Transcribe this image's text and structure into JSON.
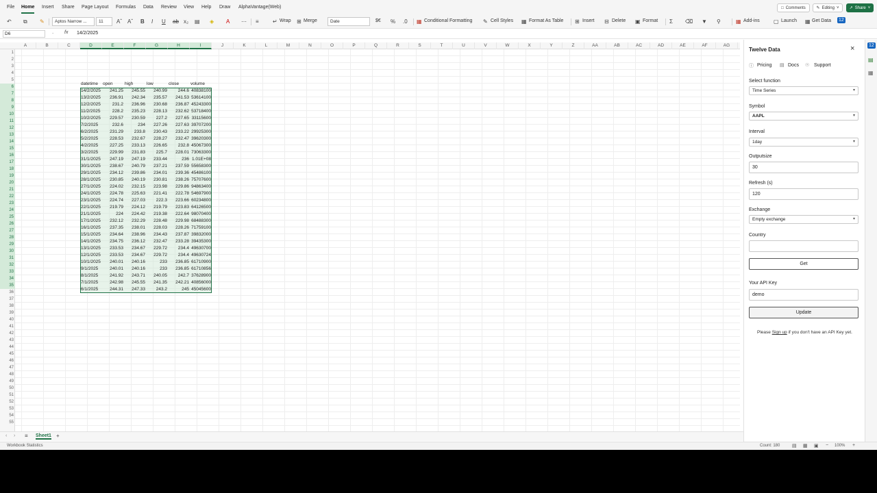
{
  "menu": {
    "tabs": [
      "File",
      "Home",
      "Insert",
      "Share",
      "Page Layout",
      "Formulas",
      "Data",
      "Review",
      "View",
      "Help",
      "Draw",
      "AlphaVantage(Web)"
    ],
    "comments": "Comments",
    "editing": "Editing",
    "share": "Share"
  },
  "ribbon": {
    "font_name": "Aptos Narrow ...",
    "font_size": "11",
    "wrap": "Wrap",
    "merge": "Merge",
    "number_format": "Date",
    "currency": "$€",
    "conditional_formatting": "Conditional Formatting",
    "cell_styles": "Cell Styles",
    "format_as_table": "Format As Table",
    "insert": "Insert",
    "delete": "Delete",
    "format": "Format",
    "add_ins": "Add-ins",
    "launch": "Launch",
    "get_data": "Get Data",
    "twelve_badge": "12"
  },
  "formula": {
    "cell_ref": "D6",
    "fx": "fx",
    "value": "14/2/2025"
  },
  "grid": {
    "columns": [
      "A",
      "B",
      "C",
      "D",
      "E",
      "F",
      "G",
      "H",
      "I",
      "J",
      "K",
      "L",
      "M",
      "N",
      "O",
      "P",
      "Q",
      "R",
      "S",
      "T",
      "U",
      "V",
      "W",
      "X",
      "Y",
      "Z",
      "AA",
      "AB",
      "AC",
      "AD",
      "AE",
      "AF",
      "AG"
    ],
    "headers": [
      "datetime",
      "open",
      "high",
      "low",
      "close",
      "volume"
    ],
    "rows": [
      [
        "14/2/2025",
        "241.25",
        "245.55",
        "240.99",
        "244.6",
        "40838100"
      ],
      [
        "13/2/2025",
        "236.91",
        "242.34",
        "235.57",
        "241.53",
        "53614100"
      ],
      [
        "12/2/2025",
        "231.2",
        "236.96",
        "230.68",
        "236.87",
        "45243300"
      ],
      [
        "11/2/2025",
        "228.2",
        "235.23",
        "228.13",
        "232.62",
        "53718400"
      ],
      [
        "10/2/2025",
        "229.57",
        "230.59",
        "227.2",
        "227.65",
        "33115600"
      ],
      [
        "7/2/2025",
        "232.6",
        "234",
        "227.26",
        "227.63",
        "39707200"
      ],
      [
        "6/2/2025",
        "231.29",
        "233.8",
        "230.43",
        "233.22",
        "29925300"
      ],
      [
        "5/2/2025",
        "228.53",
        "232.67",
        "228.27",
        "232.47",
        "39620300"
      ],
      [
        "4/2/2025",
        "227.25",
        "233.13",
        "226.65",
        "232.8",
        "45067300"
      ],
      [
        "3/2/2025",
        "229.99",
        "231.83",
        "225.7",
        "228.01",
        "73063300"
      ],
      [
        "31/1/2025",
        "247.19",
        "247.19",
        "233.44",
        "236",
        "1.01E+08"
      ],
      [
        "30/1/2025",
        "238.67",
        "240.79",
        "237.21",
        "237.59",
        "55658300"
      ],
      [
        "29/1/2025",
        "234.12",
        "239.86",
        "234.01",
        "239.36",
        "45486100"
      ],
      [
        "28/1/2025",
        "230.85",
        "240.19",
        "230.81",
        "238.26",
        "75707600"
      ],
      [
        "27/1/2025",
        "224.02",
        "232.15",
        "223.98",
        "229.86",
        "94863400"
      ],
      [
        "24/1/2025",
        "224.78",
        "225.63",
        "221.41",
        "222.78",
        "54697900"
      ],
      [
        "23/1/2025",
        "224.74",
        "227.03",
        "222.3",
        "223.66",
        "60234800"
      ],
      [
        "22/1/2025",
        "219.79",
        "224.12",
        "219.79",
        "223.83",
        "64126500"
      ],
      [
        "21/1/2025",
        "224",
        "224.42",
        "219.38",
        "222.64",
        "98070400"
      ],
      [
        "17/1/2025",
        "232.12",
        "232.29",
        "228.48",
        "229.98",
        "68488300"
      ],
      [
        "16/1/2025",
        "237.35",
        "238.01",
        "228.03",
        "228.26",
        "71759100"
      ],
      [
        "15/1/2025",
        "234.64",
        "238.96",
        "234.43",
        "237.87",
        "39832000"
      ],
      [
        "14/1/2025",
        "234.75",
        "236.12",
        "232.47",
        "233.28",
        "39435300"
      ],
      [
        "13/1/2025",
        "233.53",
        "234.67",
        "229.72",
        "234.4",
        "49630700"
      ],
      [
        "12/1/2025",
        "233.53",
        "234.67",
        "229.72",
        "234.4",
        "49630724"
      ],
      [
        "10/1/2025",
        "240.01",
        "240.16",
        "233",
        "236.85",
        "61710900"
      ],
      [
        "9/1/2025",
        "240.01",
        "240.16",
        "233",
        "236.85",
        "61710856"
      ],
      [
        "8/1/2025",
        "241.92",
        "243.71",
        "240.05",
        "242.7",
        "37628900"
      ],
      [
        "7/1/2025",
        "242.98",
        "245.55",
        "241.35",
        "242.21",
        "40856000"
      ],
      [
        "6/1/2025",
        "244.31",
        "247.33",
        "243.2",
        "245",
        "45045600"
      ]
    ]
  },
  "sheet": {
    "tab": "Sheet1",
    "add": "+"
  },
  "status": {
    "left": "Workbook Statistics",
    "count": "Count: 180",
    "zoom": "100%"
  },
  "panel": {
    "title": "Twelve Data",
    "links": [
      "Pricing",
      "Docs",
      "Support"
    ],
    "function_label": "Select function",
    "function_value": "Time Series",
    "symbol_label": "Symbol",
    "symbol_value": "AAPL",
    "interval_label": "Interval",
    "interval_value": "1day",
    "outputsize_label": "Outputsize",
    "outputsize_value": "30",
    "refresh_label": "Refresh (s)",
    "refresh_value": "120",
    "exchange_label": "Exchange",
    "exchange_value": "Empty exchange",
    "country_label": "Country",
    "country_value": "",
    "get_button": "Get",
    "api_label": "Your API Key",
    "api_value": "demo",
    "update_button": "Update",
    "note_before": "Please ",
    "note_link": "Sign up",
    "note_after": " if you don't have an API Key yet."
  }
}
